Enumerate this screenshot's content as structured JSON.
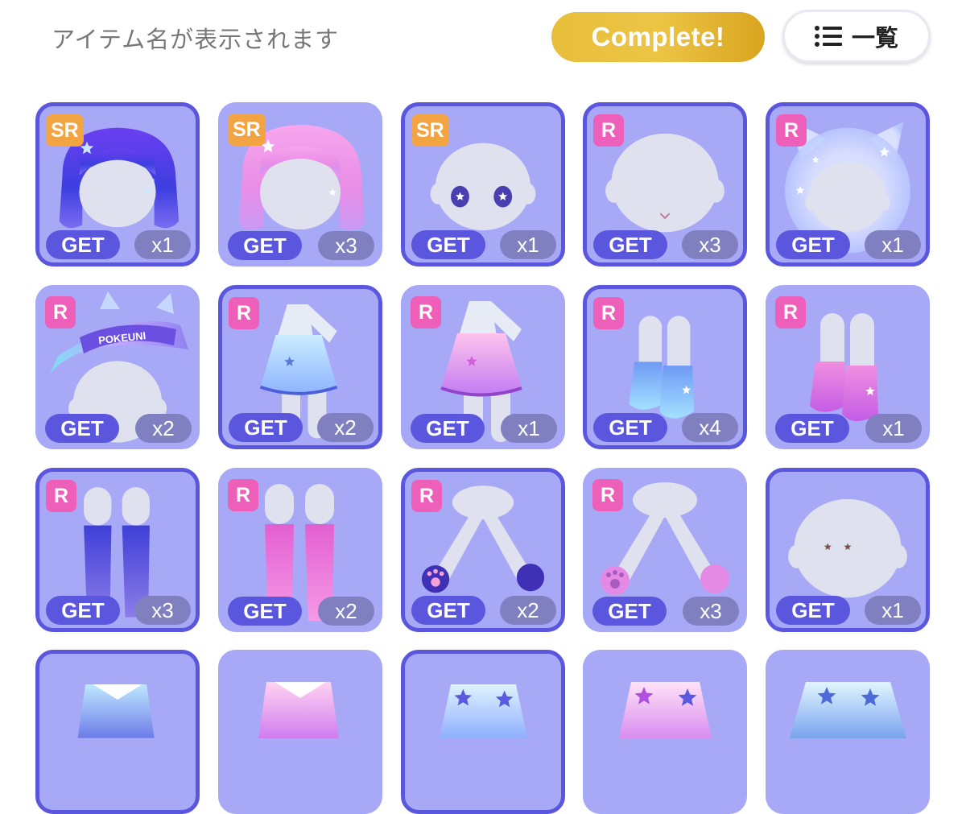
{
  "header": {
    "title": "アイテム名が表示されます",
    "complete_label": "Complete!",
    "list_label": "一覧",
    "list_icon": "list-icon"
  },
  "colors": {
    "card_bg": "#a7a8f6",
    "selected_border": "#5b56de",
    "get_badge": "#5b56de",
    "count_badge": "#807fbf",
    "sr_badge": "#f2a443",
    "r_badge": "#ee5fba",
    "complete_gold": "#e7be3a"
  },
  "items": [
    {
      "rarity": "SR",
      "get": "GET",
      "count": "x1",
      "art": "hair-purple",
      "selected": true
    },
    {
      "rarity": "SR",
      "get": "GET",
      "count": "x3",
      "art": "hair-pink",
      "selected": false
    },
    {
      "rarity": "SR",
      "get": "GET",
      "count": "x1",
      "art": "face-star-eyes",
      "selected": true
    },
    {
      "rarity": "R",
      "get": "GET",
      "count": "x3",
      "art": "face-mouth",
      "selected": true
    },
    {
      "rarity": "R",
      "get": "GET",
      "count": "x1",
      "art": "cat-bubble",
      "selected": true
    },
    {
      "rarity": "R",
      "get": "GET",
      "count": "x2",
      "art": "visor",
      "visor_text": "POKEUNI",
      "selected": false
    },
    {
      "rarity": "R",
      "get": "GET",
      "count": "x2",
      "art": "dress-blue",
      "selected": true
    },
    {
      "rarity": "R",
      "get": "GET",
      "count": "x1",
      "art": "dress-pink",
      "selected": false
    },
    {
      "rarity": "R",
      "get": "GET",
      "count": "x4",
      "art": "boots-blue",
      "selected": true
    },
    {
      "rarity": "R",
      "get": "GET",
      "count": "x1",
      "art": "boots-pink",
      "selected": false
    },
    {
      "rarity": "R",
      "get": "GET",
      "count": "x3",
      "art": "socks-purple",
      "selected": true
    },
    {
      "rarity": "R",
      "get": "GET",
      "count": "x2",
      "art": "socks-pink",
      "selected": false
    },
    {
      "rarity": "R",
      "get": "GET",
      "count": "x2",
      "art": "paws-purple",
      "selected": true
    },
    {
      "rarity": "R",
      "get": "GET",
      "count": "x3",
      "art": "paws-pink",
      "selected": false
    },
    {
      "rarity": "",
      "get": "GET",
      "count": "x1",
      "art": "face-dots",
      "selected": true
    },
    {
      "rarity": "",
      "get": "",
      "count": "",
      "art": "top-blue",
      "selected": true
    },
    {
      "rarity": "",
      "get": "",
      "count": "",
      "art": "top-pink",
      "selected": false
    },
    {
      "rarity": "",
      "get": "",
      "count": "",
      "art": "skirt-blue",
      "selected": true
    },
    {
      "rarity": "",
      "get": "",
      "count": "",
      "art": "skirt-pink",
      "selected": false
    },
    {
      "rarity": "",
      "get": "",
      "count": "",
      "art": "skirt-cyan",
      "selected": false
    }
  ]
}
